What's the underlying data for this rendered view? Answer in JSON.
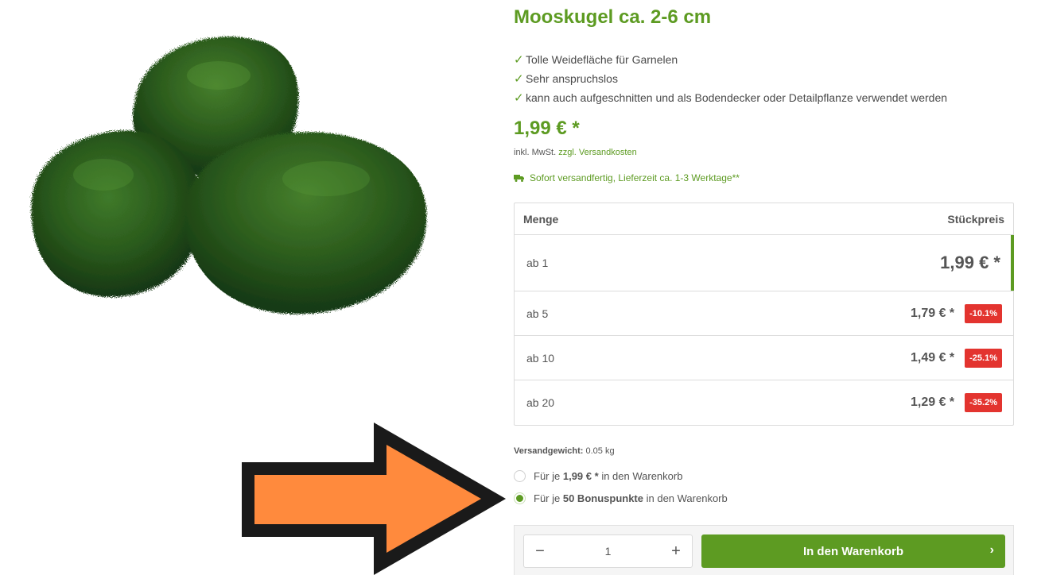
{
  "product": {
    "title": "Mooskugel ca. 2-6 cm",
    "image_icon": "moss-ball-image"
  },
  "features": [
    "Tolle Weidefläche für Garnelen",
    "Sehr anspruchslos",
    "kann auch aufgeschnitten und als Bodendecker oder Detailpflanze verwendet werden"
  ],
  "price": {
    "main": "1,99 € *",
    "tax_prefix": "inkl. MwSt.",
    "shipping_link": "zzgl. Versandkosten"
  },
  "delivery": {
    "text": "Sofort versandfertig, Lieferzeit ca. 1-3 Werktage**",
    "icon": "truck-icon"
  },
  "block_prices": {
    "header_qty": "Menge",
    "header_price": "Stückpreis",
    "rows": [
      {
        "qty": "ab 1",
        "price": "1,99 € *",
        "discount": ""
      },
      {
        "qty": "ab 5",
        "price": "1,79 € *",
        "discount": "-10.1%"
      },
      {
        "qty": "ab 10",
        "price": "1,49 € *",
        "discount": "-25.1%"
      },
      {
        "qty": "ab 20",
        "price": "1,29 € *",
        "discount": "-35.2%"
      }
    ]
  },
  "weight": {
    "label": "Versandgewicht:",
    "value": "0.05 kg"
  },
  "purchase_options": [
    {
      "prefix": "Für je",
      "bold": "1,99 € *",
      "suffix": "in den Warenkorb",
      "selected": false
    },
    {
      "prefix": "Für je",
      "bold": "50 Bonuspunkte",
      "suffix": "in den Warenkorb",
      "selected": true
    }
  ],
  "buy": {
    "quantity": "1",
    "minus_icon": "minus-icon",
    "plus_icon": "plus-icon",
    "cart_label": "In den Warenkorb",
    "chevron_icon": "chevron-right-icon"
  },
  "colors": {
    "brand_green": "#5d9b22",
    "discount_red": "#e3342f",
    "arrow_orange": "#ff8a3d"
  }
}
